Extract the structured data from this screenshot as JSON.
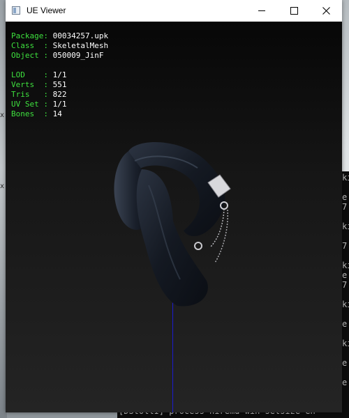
{
  "window": {
    "title": "UE Viewer",
    "icon": "app-window-icon"
  },
  "info": {
    "package": {
      "label": "Package:",
      "value": "00034257.upk"
    },
    "class": {
      "label": "Class  :",
      "value": "SkeletalMesh"
    },
    "object": {
      "label": "Object :",
      "value": "050009_JinF"
    },
    "lod": {
      "label": "LOD    :",
      "value": "1/1"
    },
    "verts": {
      "label": "Verts  :",
      "value": "551"
    },
    "tris": {
      "label": "Tris   :",
      "value": "822"
    },
    "uvset": {
      "label": "UV Set :",
      "value": "1/1"
    },
    "bones": {
      "label": "Bones  :",
      "value": "14"
    }
  },
  "console": {
    "bottom_line": "[DStollI] process  hiremd win setsize  en"
  },
  "colors": {
    "label_green": "#3ee03e",
    "axis_blue": "#1b1bd0",
    "mesh_dark": "#1a1f2a"
  }
}
